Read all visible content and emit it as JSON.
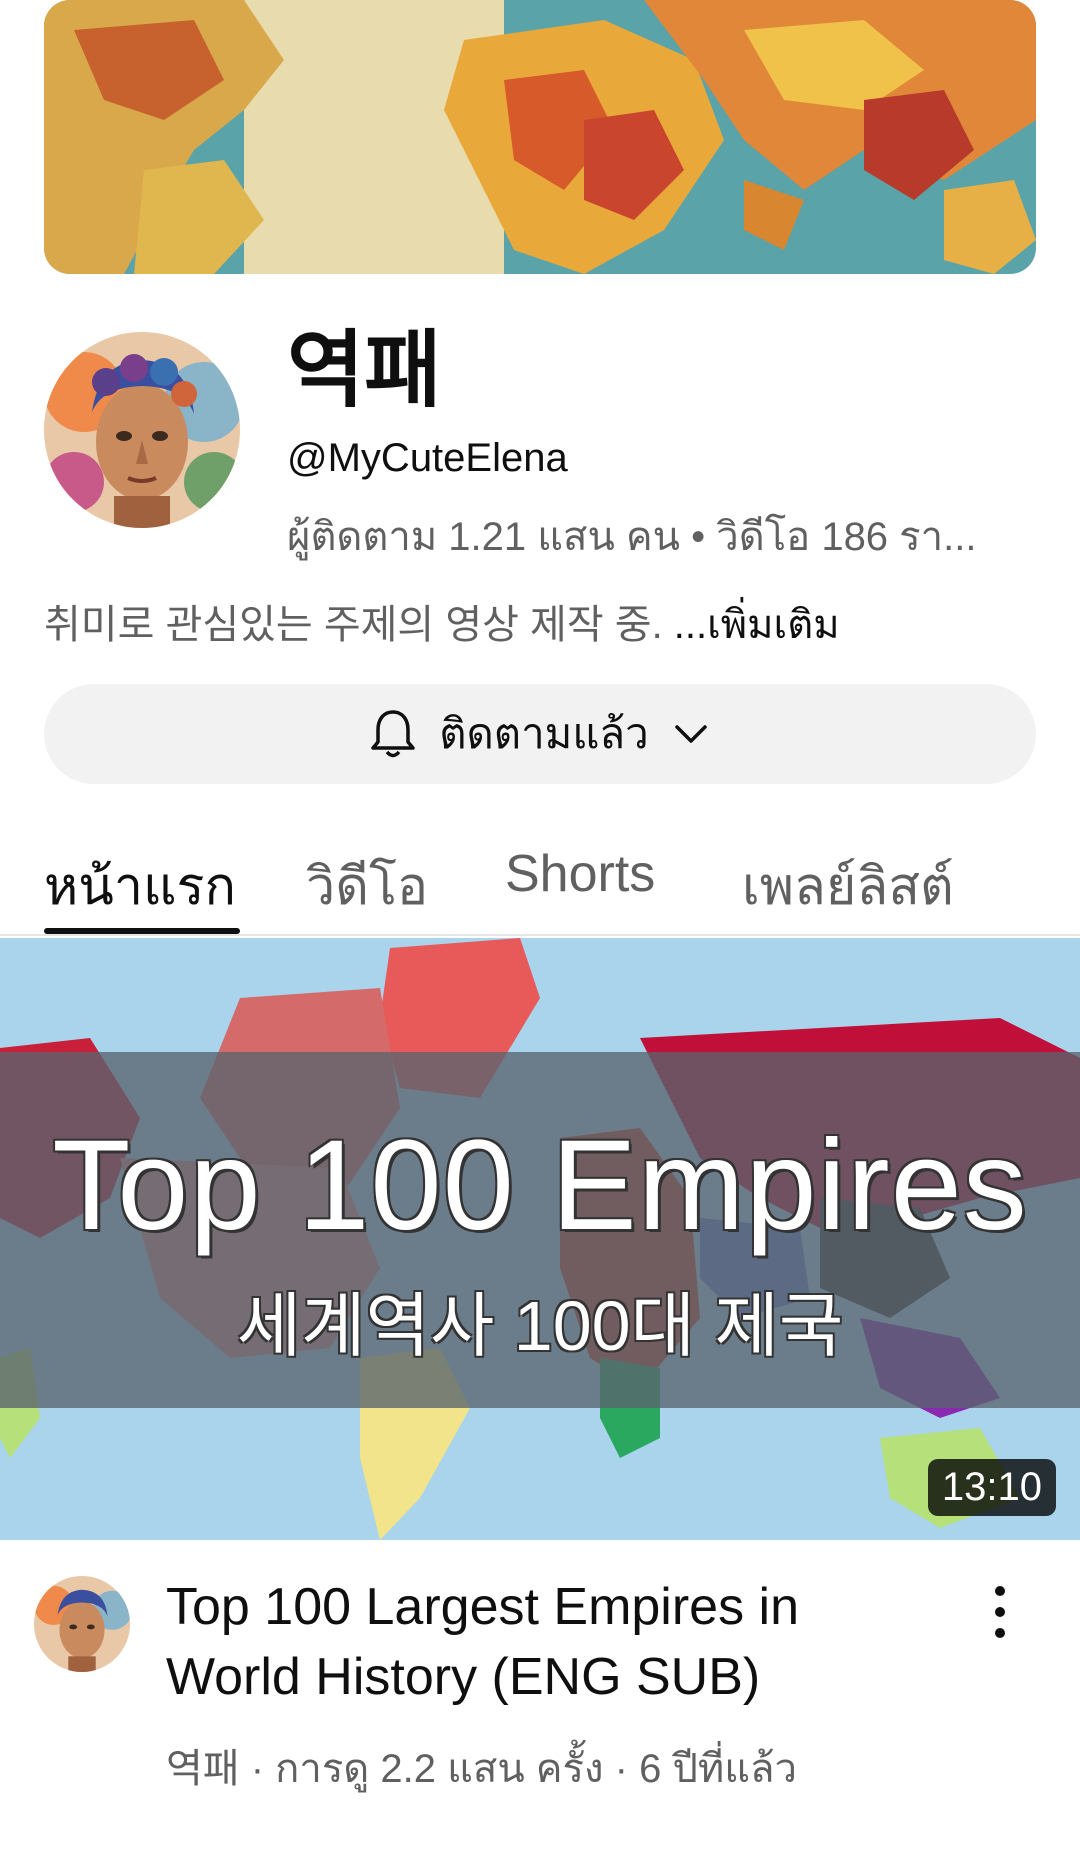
{
  "channel": {
    "name": "역패",
    "handle": "@MyCuteElena",
    "stats": "ผู้ติดตาม 1.21 แสน คน • วิดีโอ 186 รา...",
    "description": "취미로 관심있는 주제의 영상 제작 중. ",
    "description_more": "...เพิ่มเติม"
  },
  "subscribe": {
    "label": "ติดตามแล้ว",
    "icon_left": "bell-icon",
    "icon_right": "chevron-down-icon"
  },
  "tabs": [
    {
      "label": "หน้าแรก",
      "active": true
    },
    {
      "label": "วิดีโอ",
      "active": false
    },
    {
      "label": "Shorts",
      "active": false
    },
    {
      "label": "เพลย์ลิสต์",
      "active": false
    }
  ],
  "video": {
    "thumbnail_title": "Top 100 Empires",
    "thumbnail_subtitle": "세계역사 100대 제국",
    "duration": "13:10",
    "title": "Top 100 Largest Empires in World History (ENG SUB)",
    "meta": "역패 · การดู 2.2 แสน ครั้ง · 6 ปีที่แล้ว",
    "more_icon": "more-vertical-icon"
  },
  "colors": {
    "text_primary": "#0f0f0f",
    "text_secondary": "#606060",
    "button_bg": "#f2f2f2"
  }
}
